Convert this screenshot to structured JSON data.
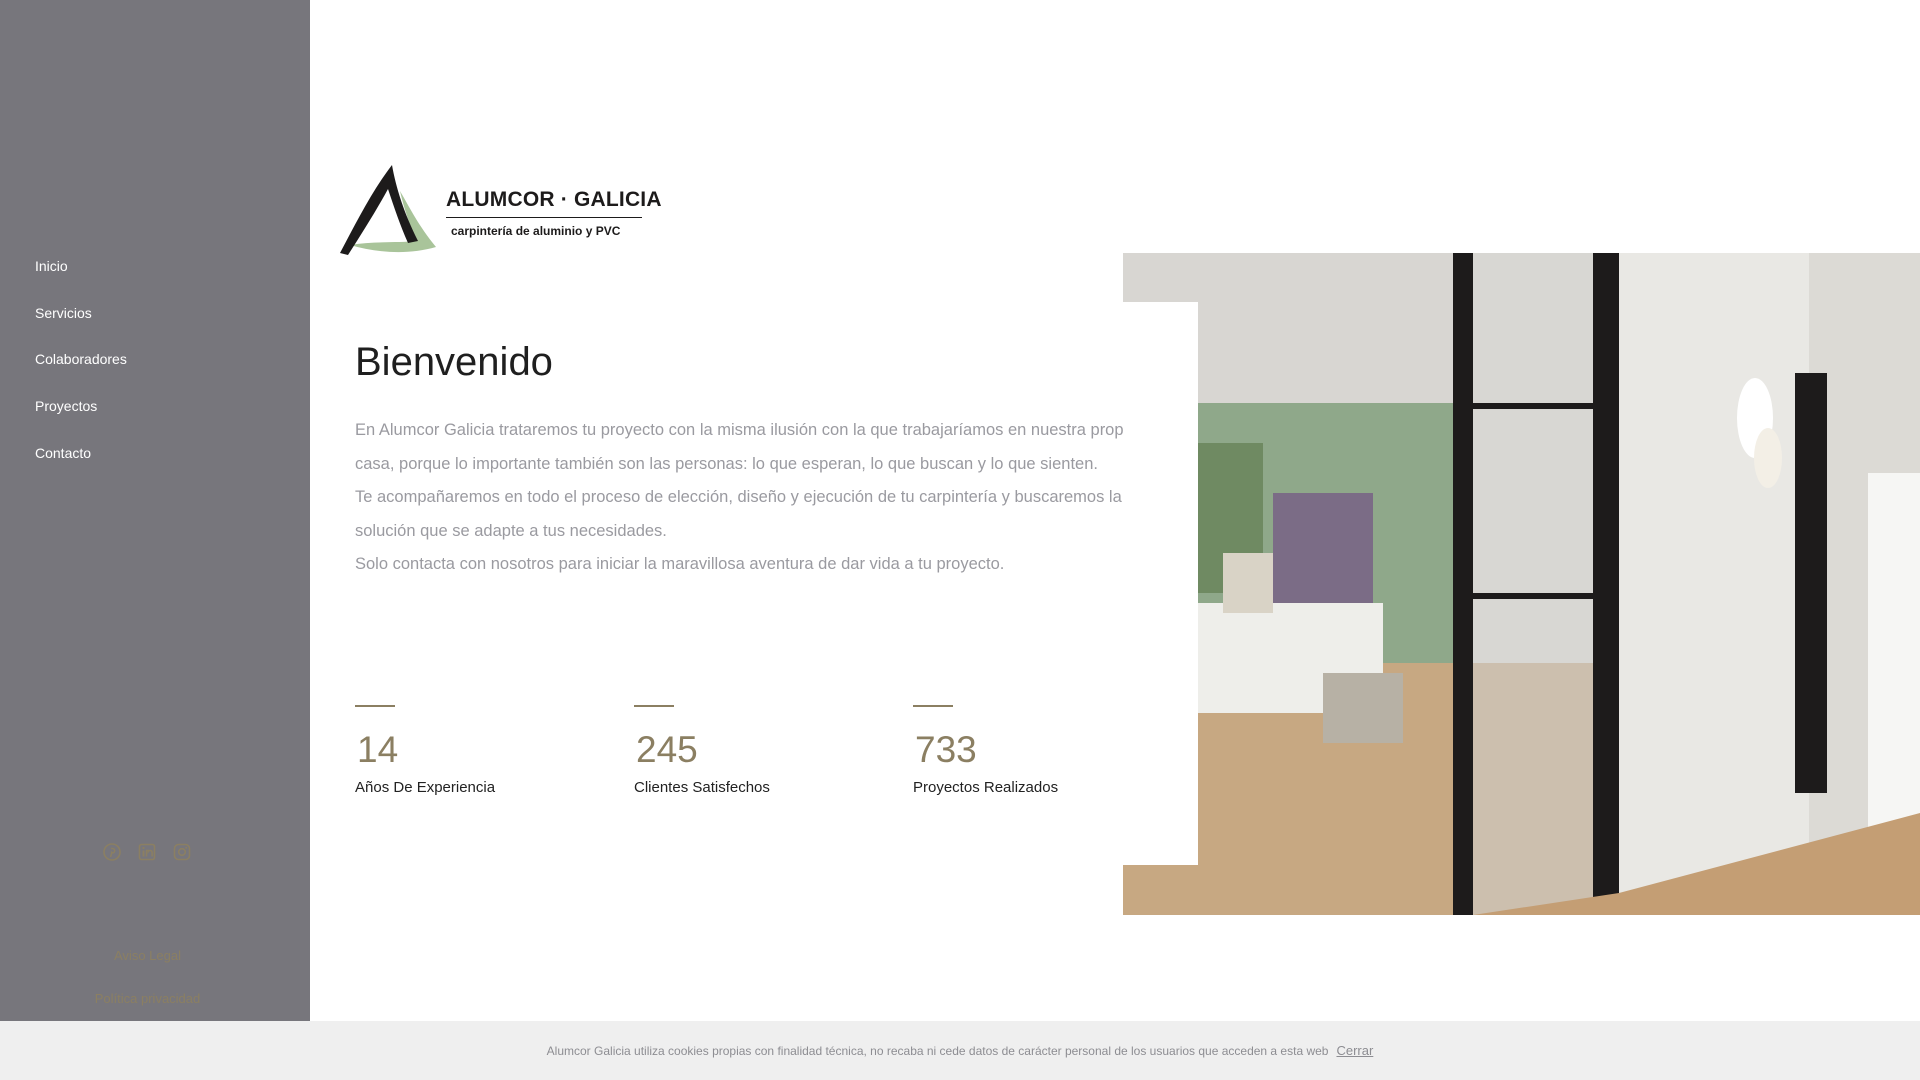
{
  "brand": {
    "name": "ALUMCOR · GALICIA",
    "tagline": "carpintería de aluminio y PVC"
  },
  "sidebar": {
    "nav": [
      {
        "label": "Inicio"
      },
      {
        "label": "Servicios"
      },
      {
        "label": "Colaboradores"
      },
      {
        "label": "Proyectos"
      },
      {
        "label": "Contacto"
      }
    ],
    "social_icons": [
      "pinterest-icon",
      "linkedin-icon",
      "instagram-icon"
    ],
    "legal_links": [
      {
        "label": "Aviso Legal"
      },
      {
        "label": "Política privacidad"
      }
    ]
  },
  "main": {
    "title": "Bienvenido",
    "paragraphs": [
      "En Alumcor Galicia trataremos tu proyecto con la misma ilusión con la que trabajaríamos en nuestra propia casa, porque lo importante también son las personas: lo que esperan, lo que buscan y lo que sienten.",
      "Te acompañaremos en todo el proceso de elección, diseño y ejecución de tu carpintería y buscaremos la mejor solución que se adapte a tus necesidades.",
      "Solo contacta con nosotros para iniciar la maravillosa aventura de dar vida a tu proyecto."
    ],
    "stats": [
      {
        "number": "14",
        "label": "Años De Experiencia"
      },
      {
        "number": "245",
        "label": "Clientes Satisfechos"
      },
      {
        "number": "733",
        "label": "Proyectos Realizados"
      }
    ]
  },
  "cookie_banner": {
    "text": "Alumcor Galicia utiliza cookies propias con finalidad técnica, no recaba ni cede datos de carácter personal de los usuarios que acceden a esta web",
    "close_label": "Cerrar"
  },
  "colors": {
    "sidebar_bg": "#77767c",
    "accent": "#8b7f62",
    "logo_green": "#a9c49a"
  }
}
